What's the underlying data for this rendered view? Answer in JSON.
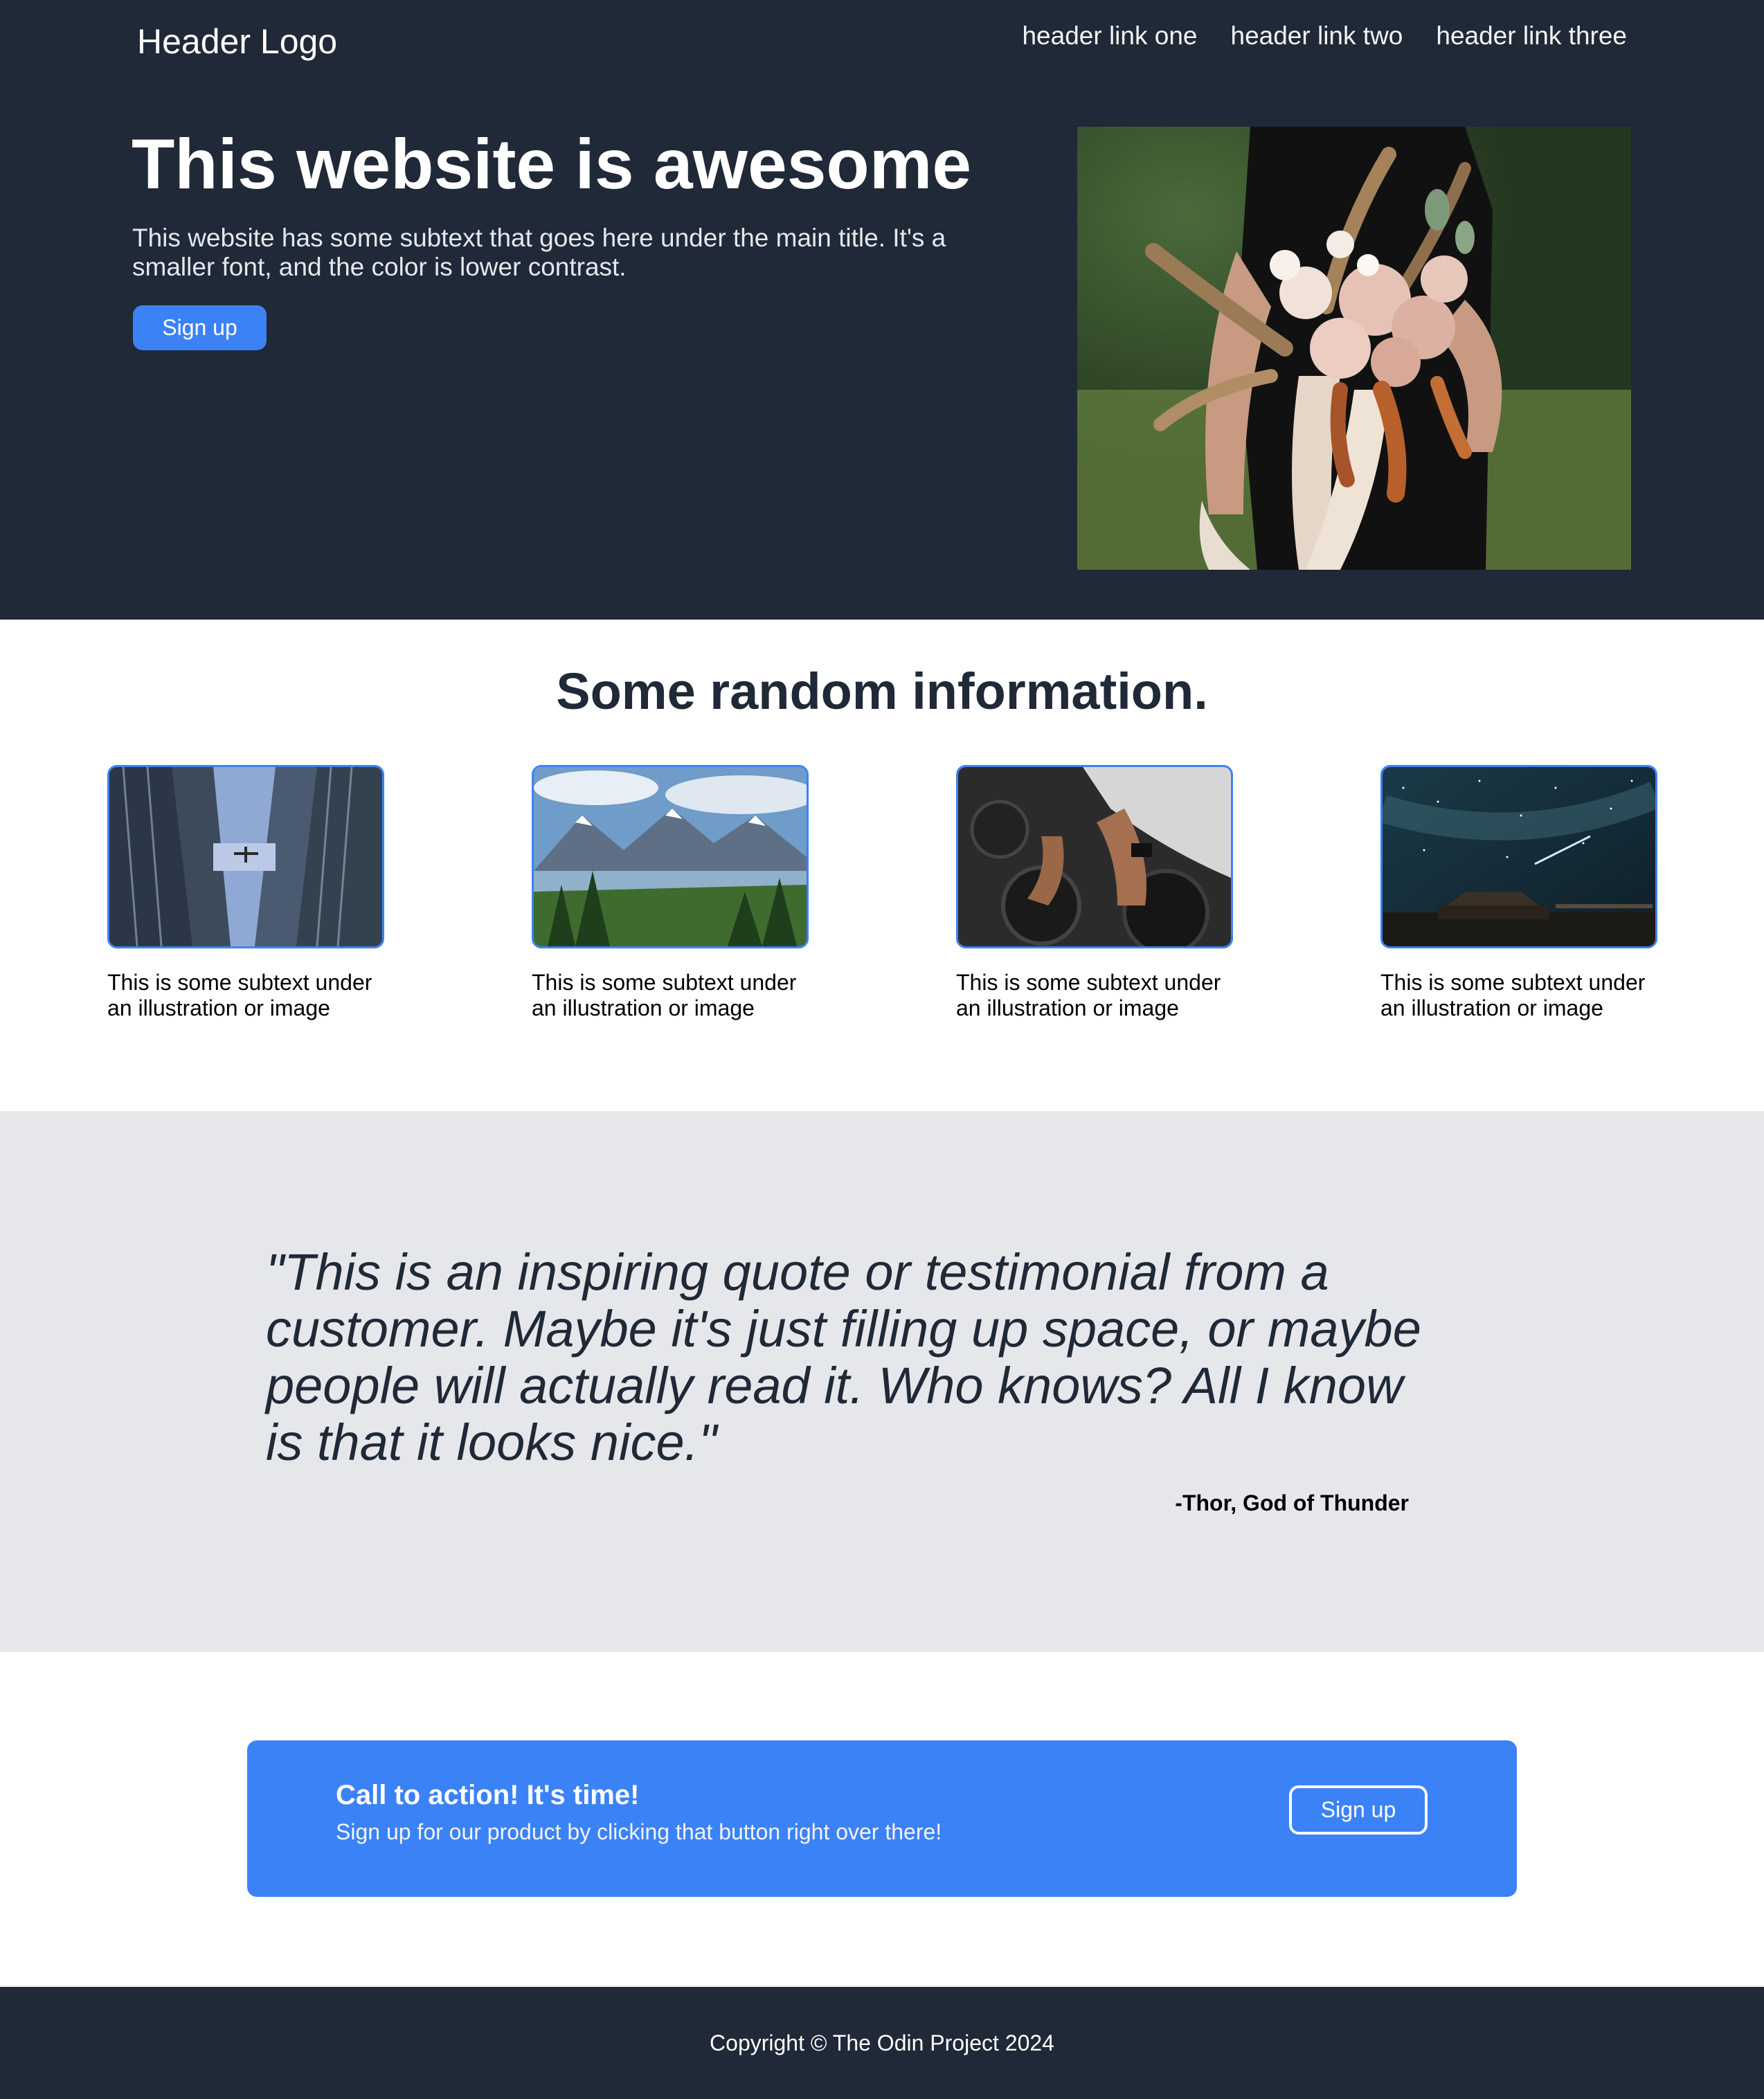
{
  "header": {
    "logo": "Header Logo",
    "nav": [
      "header link one",
      "header link two",
      "header link three"
    ]
  },
  "hero": {
    "title": "This website is awesome",
    "subtitle": "This website has some subtext that goes here under the main title. It's a smaller font, and the color is lower contrast.",
    "button_label": "Sign up",
    "image_icon": "bouquet-photo"
  },
  "info": {
    "title": "Some random information.",
    "cards": [
      {
        "icon": "skyscrapers-photo",
        "text": "This is some subtext under an illustration or image"
      },
      {
        "icon": "mountains-photo",
        "text": "This is some subtext under an illustration or image"
      },
      {
        "icon": "dumbbells-photo",
        "text": "This is some subtext under an illustration or image"
      },
      {
        "icon": "night-sky-photo",
        "text": "This is some subtext under an illustration or image"
      }
    ]
  },
  "quote": {
    "text": "\"This is an inspiring quote or testimonial from a customer. Maybe it's just filling up space, or maybe people will actually read it. Who knows? All I know is that it looks nice.\"",
    "author": "-Thor, God of Thunder"
  },
  "cta": {
    "title": "Call to action! It's time!",
    "subtitle": "Sign up for our product by clicking that button right over there!",
    "button_label": "Sign up"
  },
  "footer": {
    "copyright": "Copyright © The Odin Project 2024"
  },
  "colors": {
    "dark": "#1f2937",
    "accent": "#3b82f6",
    "light_gray": "#e5e7eb"
  }
}
